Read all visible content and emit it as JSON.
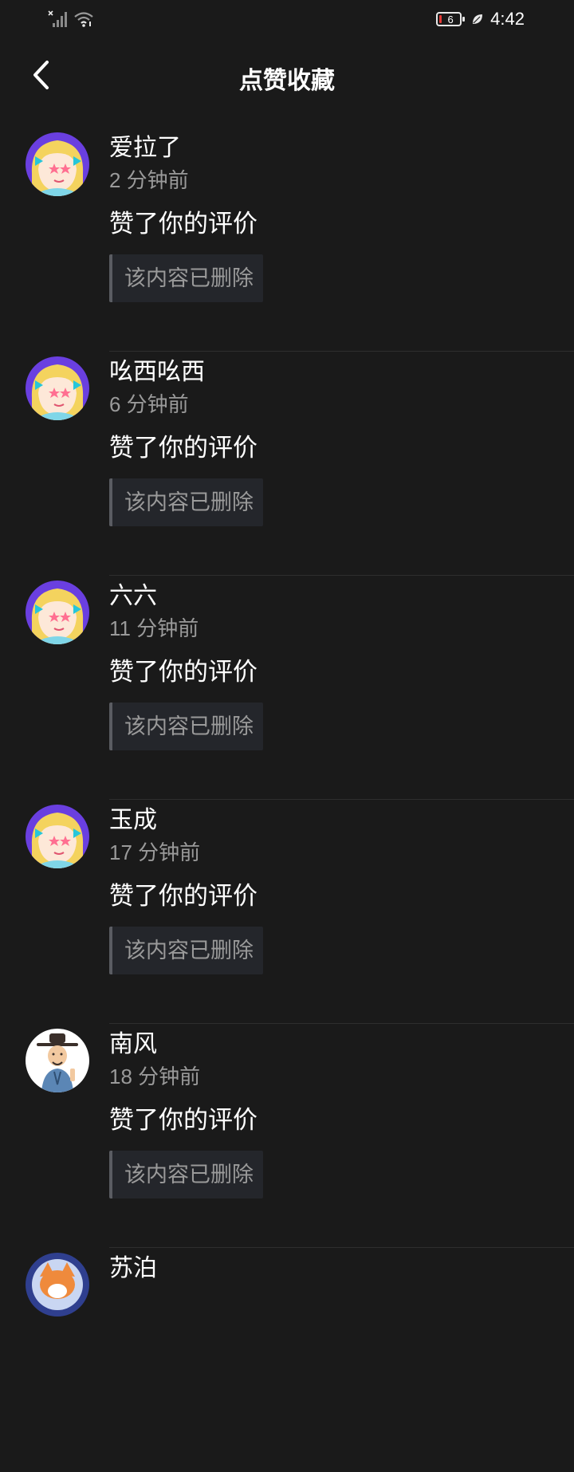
{
  "status_bar": {
    "battery_level": "6",
    "time": "4:42",
    "icons": [
      "no-sim-signal-icon",
      "wifi-icon",
      "battery-icon",
      "leaf-icon"
    ]
  },
  "header": {
    "title": "点赞收藏",
    "back_icon": "chevron-left-icon"
  },
  "notifications": [
    {
      "username": "爱拉了",
      "time": "2 分钟前",
      "action": "赞了你的评价",
      "deleted_text": "该内容已删除",
      "avatar": "anime-avatar"
    },
    {
      "username": "吆西吆西",
      "time": "6 分钟前",
      "action": "赞了你的评价",
      "deleted_text": "该内容已删除",
      "avatar": "anime-avatar"
    },
    {
      "username": "六六",
      "time": "11 分钟前",
      "action": "赞了你的评价",
      "deleted_text": "该内容已删除",
      "avatar": "anime-avatar"
    },
    {
      "username": "玉成",
      "time": "17 分钟前",
      "action": "赞了你的评价",
      "deleted_text": "该内容已删除",
      "avatar": "anime-avatar"
    },
    {
      "username": "南风",
      "time": "18 分钟前",
      "action": "赞了你的评价",
      "deleted_text": "该内容已删除",
      "avatar": "scholar-avatar"
    },
    {
      "username": "苏泊",
      "avatar": "fox-avatar"
    }
  ],
  "colors": {
    "background": "#1a1a1a",
    "secondary_text": "#9a9a9a",
    "deleted_box_bg": "#24262b",
    "deleted_box_border": "#5a5c62"
  }
}
